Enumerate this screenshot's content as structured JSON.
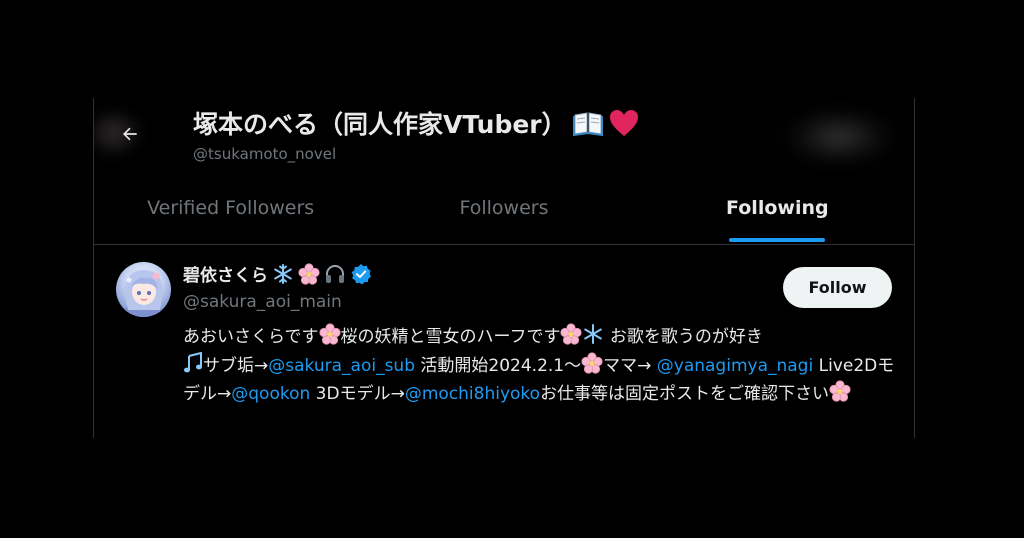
{
  "header": {
    "back_icon": "arrow-left-icon",
    "name": "塚本のべる（同人作家VTuber）",
    "name_emojis": [
      "open-book-icon",
      "red-heart-icon"
    ],
    "handle": "@tsukamoto_novel"
  },
  "tabs": [
    {
      "label": "Verified Followers",
      "active": false
    },
    {
      "label": "Followers",
      "active": false
    },
    {
      "label": "Following",
      "active": true
    }
  ],
  "colors": {
    "accent": "#1d9bf0",
    "background": "#000000",
    "text_primary": "#e7e9ea",
    "text_secondary": "#71767b",
    "border": "#2f3336"
  },
  "user": {
    "name": "碧依さくら",
    "name_emojis": [
      "snowflake-icon",
      "cherry-blossom-icon",
      "headphones-icon"
    ],
    "verified_icon": "verified-badge-icon",
    "handle": "@sakura_aoi_main",
    "follow_label": "Follow",
    "bio": {
      "p1": "あおいさくらです",
      "p2": "桜の妖精と雪女のハーフです",
      "p3": " お歌を歌うのが好き",
      "p4": "サブ垢→",
      "link1": "@sakura_aoi_sub",
      "p5": " 活動開始2024.2.1〜",
      "p6": "ママ→ ",
      "link2": "@yanagimya_nagi",
      "p7": " Live2Dモデル→",
      "link3": "@qookon",
      "p8": " 3Dモデル→",
      "link4": "@mochi8hiyoko",
      "p9": "お仕事等は固定ポストをご確認下さい"
    }
  }
}
